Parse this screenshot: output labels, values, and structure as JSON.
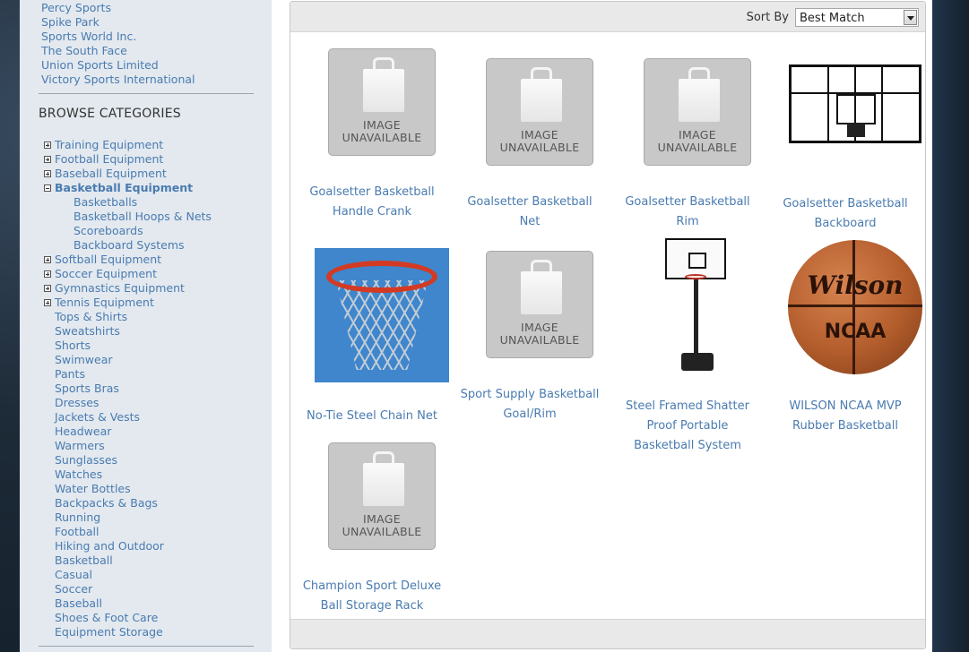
{
  "sidebar": {
    "brands": [
      "Percy Sports",
      "Spike Park",
      "Sports World Inc.",
      "The South Face",
      "Union Sports Limited",
      "Victory Sports International"
    ],
    "browse_title": "BROWSE CATEGORIES",
    "categories": [
      {
        "label": "Training Equipment",
        "toggle": "plus"
      },
      {
        "label": "Football Equipment",
        "toggle": "plus"
      },
      {
        "label": "Baseball Equipment",
        "toggle": "plus"
      },
      {
        "label": "Basketball Equipment",
        "toggle": "minus",
        "active": true
      },
      {
        "label": "Basketballs",
        "sub": true
      },
      {
        "label": "Basketball Hoops & Nets",
        "sub": true
      },
      {
        "label": "Scoreboards",
        "sub": true
      },
      {
        "label": "Backboard Systems",
        "sub": true
      },
      {
        "label": "Softball Equipment",
        "toggle": "plus"
      },
      {
        "label": "Soccer Equipment",
        "toggle": "plus"
      },
      {
        "label": "Gymnastics Equipment",
        "toggle": "plus"
      },
      {
        "label": "Tennis Equipment",
        "toggle": "plus"
      },
      {
        "label": "Tops & Shirts"
      },
      {
        "label": "Sweatshirts"
      },
      {
        "label": "Shorts"
      },
      {
        "label": "Swimwear"
      },
      {
        "label": "Pants"
      },
      {
        "label": "Sports Bras"
      },
      {
        "label": "Dresses"
      },
      {
        "label": "Jackets & Vests"
      },
      {
        "label": "Headwear"
      },
      {
        "label": "Warmers"
      },
      {
        "label": "Sunglasses"
      },
      {
        "label": "Watches"
      },
      {
        "label": "Water Bottles"
      },
      {
        "label": "Backpacks & Bags"
      },
      {
        "label": "Running"
      },
      {
        "label": "Football"
      },
      {
        "label": "Hiking and Outdoor"
      },
      {
        "label": "Basketball"
      },
      {
        "label": "Casual"
      },
      {
        "label": "Soccer"
      },
      {
        "label": "Baseball"
      },
      {
        "label": "Shoes & Foot Care"
      },
      {
        "label": "Equipment Storage"
      }
    ]
  },
  "sortbar": {
    "label": "Sort By",
    "selected": "Best Match"
  },
  "image_unavailable_text": "IMAGE\nUNAVAILABLE",
  "ball_logo": {
    "brand": "Wilson",
    "mark": "NCAA"
  },
  "products": [
    {
      "name": "Goalsetter Basketball Handle Crank",
      "image": "unavailable"
    },
    {
      "name": "Goalsetter Basketball Net",
      "image": "unavailable"
    },
    {
      "name": "Goalsetter Basketball Rim",
      "image": "unavailable"
    },
    {
      "name": "Goalsetter Basketball Backboard",
      "image": "backboard"
    },
    {
      "name": "No-Tie Steel Chain Net",
      "image": "chain-net"
    },
    {
      "name": "Sport Supply Basketball Goal/Rim",
      "image": "unavailable"
    },
    {
      "name": "Steel Framed Shatter Proof Portable Basketball System",
      "image": "portable-system"
    },
    {
      "name": "WILSON NCAA MVP Rubber Basketball",
      "image": "basketball"
    },
    {
      "name": "Champion Sport Deluxe Ball Storage Rack",
      "image": "unavailable"
    }
  ]
}
